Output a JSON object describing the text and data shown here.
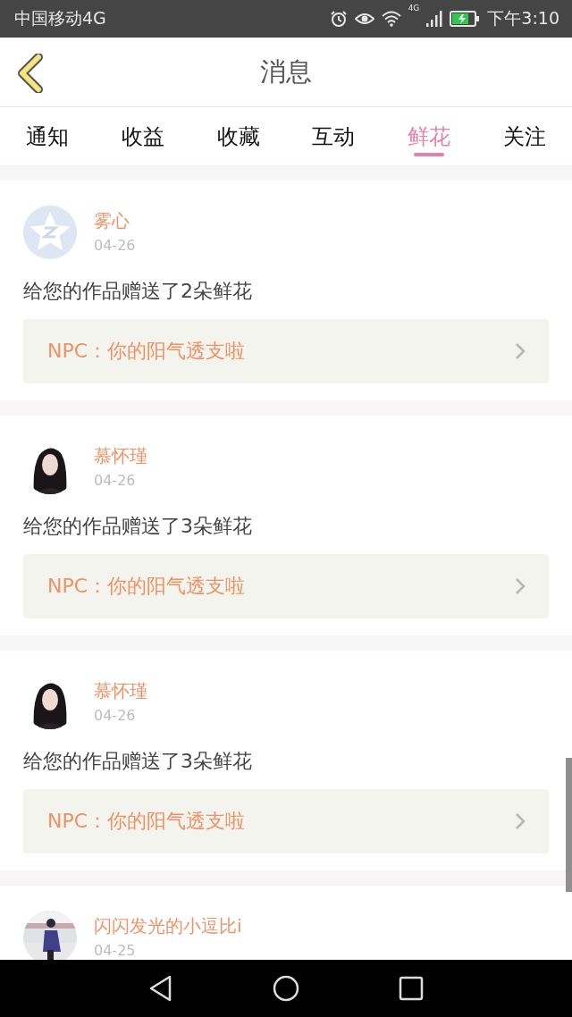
{
  "status_bar": {
    "carrier": "中国移动4G",
    "network": "4G",
    "time": "下午3:10"
  },
  "header": {
    "title": "消息"
  },
  "tabs": [
    {
      "label": "通知",
      "selected": false
    },
    {
      "label": "收益",
      "selected": false
    },
    {
      "label": "收藏",
      "selected": false
    },
    {
      "label": "互动",
      "selected": false
    },
    {
      "label": "鲜花",
      "selected": true
    },
    {
      "label": "关注",
      "selected": false
    }
  ],
  "messages": [
    {
      "avatar": {
        "kind": "icon"
      },
      "name": "雾心",
      "date": "04-26",
      "text": "给您的作品赠送了2朵鲜花",
      "reply": "NPC：你的阳气透支啦"
    },
    {
      "name": "慕怀瑾",
      "date": "04-26",
      "text": "给您的作品赠送了3朵鲜花",
      "reply": "NPC：你的阳气透支啦"
    },
    {
      "name": "慕怀瑾",
      "date": "04-26",
      "text": "给您的作品赠送了3朵鲜花",
      "reply": "NPC：你的阳气透支啦"
    },
    {
      "name": "闪闪发光的小逗比i",
      "date": "04-25"
    }
  ]
}
